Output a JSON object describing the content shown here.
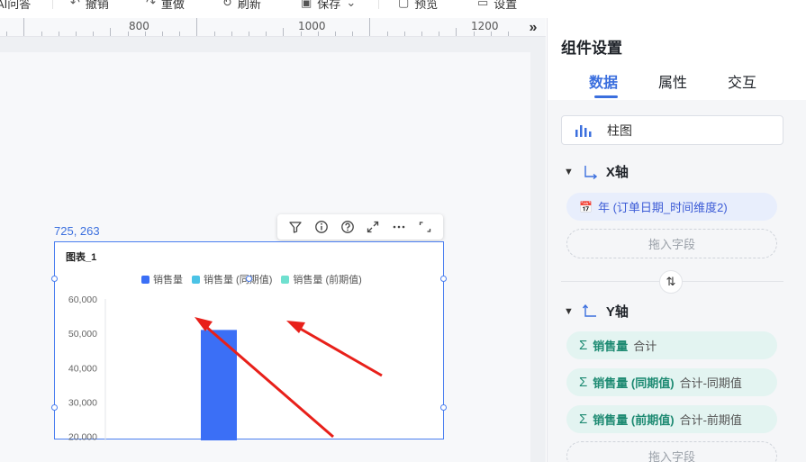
{
  "toolbar": {
    "items": [
      {
        "icon": "ai-icon",
        "label": "AI问答"
      },
      {
        "icon": "undo-icon",
        "label": "撤销"
      },
      {
        "icon": "redo-icon",
        "label": "重做"
      },
      {
        "icon": "refresh-icon",
        "label": "刷新"
      },
      {
        "icon": "save-icon",
        "label": "保存"
      },
      {
        "icon": "preview-icon",
        "label": "预览"
      },
      {
        "icon": "settings-icon",
        "label": "设置"
      }
    ],
    "more_label": "···"
  },
  "ruler": {
    "labels": [
      "800",
      "1000",
      "1200"
    ],
    "expand_icon": "»"
  },
  "canvas": {
    "coord_label": "725, 263"
  },
  "widget": {
    "title": "图表_1",
    "toolbar_icons": [
      "filter-icon",
      "info-icon",
      "help-icon",
      "fullscreen-icon",
      "more-icon",
      "collapse-icon"
    ]
  },
  "chart_data": {
    "type": "bar",
    "title": "图表_1",
    "legend": [
      {
        "name": "销售量",
        "color": "#3b6ff6"
      },
      {
        "name": "销售量 (同期值)",
        "color": "#4bc3e6"
      },
      {
        "name": "销售量 (前期值)",
        "color": "#6fe0cf"
      }
    ],
    "y_ticks": [
      "60,000",
      "50,000",
      "40,000",
      "30,000",
      "20,000"
    ],
    "ylim": [
      0,
      60000
    ],
    "series": [
      {
        "name": "销售量",
        "values": [
          51000
        ]
      }
    ],
    "grid": false,
    "legend_position": "top"
  },
  "panel": {
    "title": "组件设置",
    "tabs": [
      "数据",
      "属性",
      "交互"
    ],
    "active_tab": "数据",
    "chart_type": "柱图",
    "x_axis": {
      "label": "X轴",
      "fields": [
        {
          "icon": "date-dimension-icon",
          "text": "年 (订单日期_时间维度2)"
        }
      ],
      "drop_placeholder": "拖入字段"
    },
    "swap_icon": "⇅",
    "y_axis": {
      "label": "Y轴",
      "fields": [
        {
          "icon": "sigma-icon",
          "name": "销售量",
          "agg": "合计"
        },
        {
          "icon": "sigma-icon",
          "name": "销售量 (同期值)",
          "agg": "合计-同期值"
        },
        {
          "icon": "sigma-icon",
          "name": "销售量 (前期值)",
          "agg": "合计-前期值"
        }
      ],
      "drop_placeholder": "拖入字段"
    }
  },
  "colors": {
    "accent": "#3b6fde",
    "annotation_arrow": "#e8201a"
  }
}
